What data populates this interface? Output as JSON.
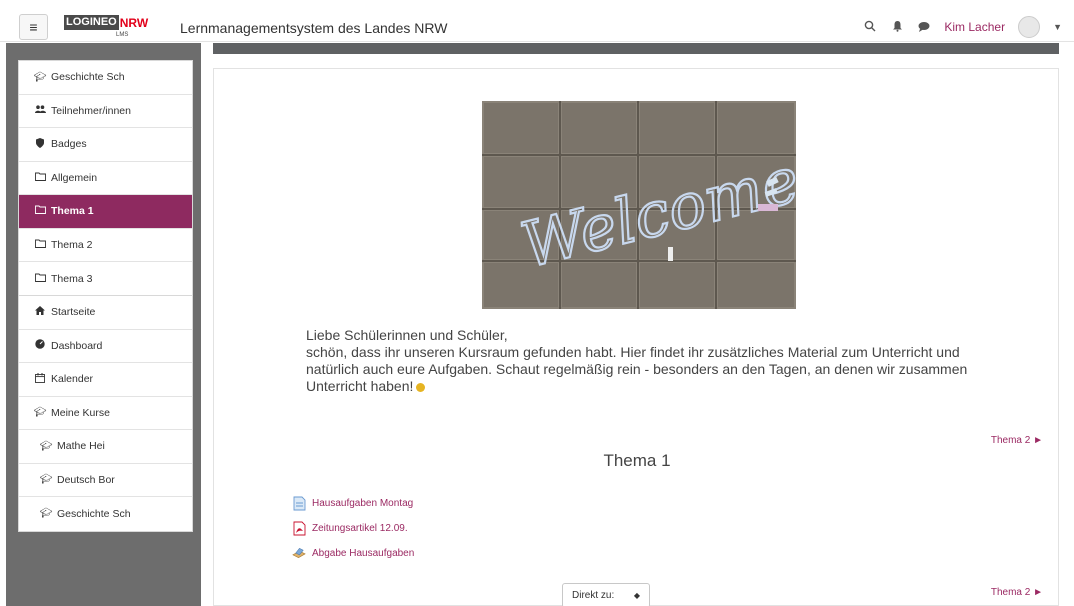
{
  "navbar": {
    "menu_icon": "hamburger-icon",
    "logo_logineo": "LOGINEO",
    "logo_nrw": "NRW",
    "logo_lms": "LMS",
    "site_title": "Lernmanagementsystem des Landes NRW",
    "user_name": "Kim Lacher",
    "icons": [
      "search-icon",
      "bell-icon",
      "chat-icon",
      "avatar-icon",
      "caret-down-icon"
    ]
  },
  "sidebar": {
    "course_items": [
      {
        "label": "Geschichte Sch",
        "icon": "graduation-cap-icon"
      },
      {
        "label": "Teilnehmer/innen",
        "icon": "users-icon"
      },
      {
        "label": "Badges",
        "icon": "shield-icon"
      },
      {
        "label": "Allgemein",
        "icon": "folder-icon"
      },
      {
        "label": "Thema 1",
        "icon": "folder-icon",
        "active": true
      },
      {
        "label": "Thema 2",
        "icon": "folder-icon"
      },
      {
        "label": "Thema 3",
        "icon": "folder-icon"
      }
    ],
    "site_items": [
      {
        "label": "Startseite",
        "icon": "home-icon"
      },
      {
        "label": "Dashboard",
        "icon": "dashboard-icon"
      },
      {
        "label": "Kalender",
        "icon": "calendar-icon"
      },
      {
        "label": "Meine Kurse",
        "icon": "graduation-cap-icon"
      },
      {
        "label": "Mathe Hei",
        "icon": "graduation-cap-icon"
      },
      {
        "label": "Deutsch Bor",
        "icon": "graduation-cap-icon"
      },
      {
        "label": "Geschichte Sch",
        "icon": "graduation-cap-icon"
      }
    ],
    "active_color": "#8e2a60"
  },
  "main": {
    "image_text": "Welcome",
    "intro": {
      "greeting": "Liebe Schülerinnen und Schüler,",
      "text": "schön, dass ihr unseren Kursraum gefunden habt. Hier findet ihr zusätzliches Material zum Unterricht und natürlich auch eure Aufgaben. Schaut regelmäßig rein - besonders an den Tagen, an denen wir zusammen Unterricht haben!"
    },
    "next_link_top": "Thema 2 ►",
    "section_title": "Thema 1",
    "activities": [
      {
        "label": "Hausaufgaben Montag",
        "icon": "page-icon"
      },
      {
        "label": "Zeitungsartikel 12.09.",
        "icon": "pdf-icon"
      },
      {
        "label": "Abgabe Hausaufgaben",
        "icon": "assignment-icon"
      }
    ],
    "jump_label": "Direkt zu:",
    "next_link_bottom": "Thema 2 ►",
    "link_color": "#9b2a63"
  }
}
